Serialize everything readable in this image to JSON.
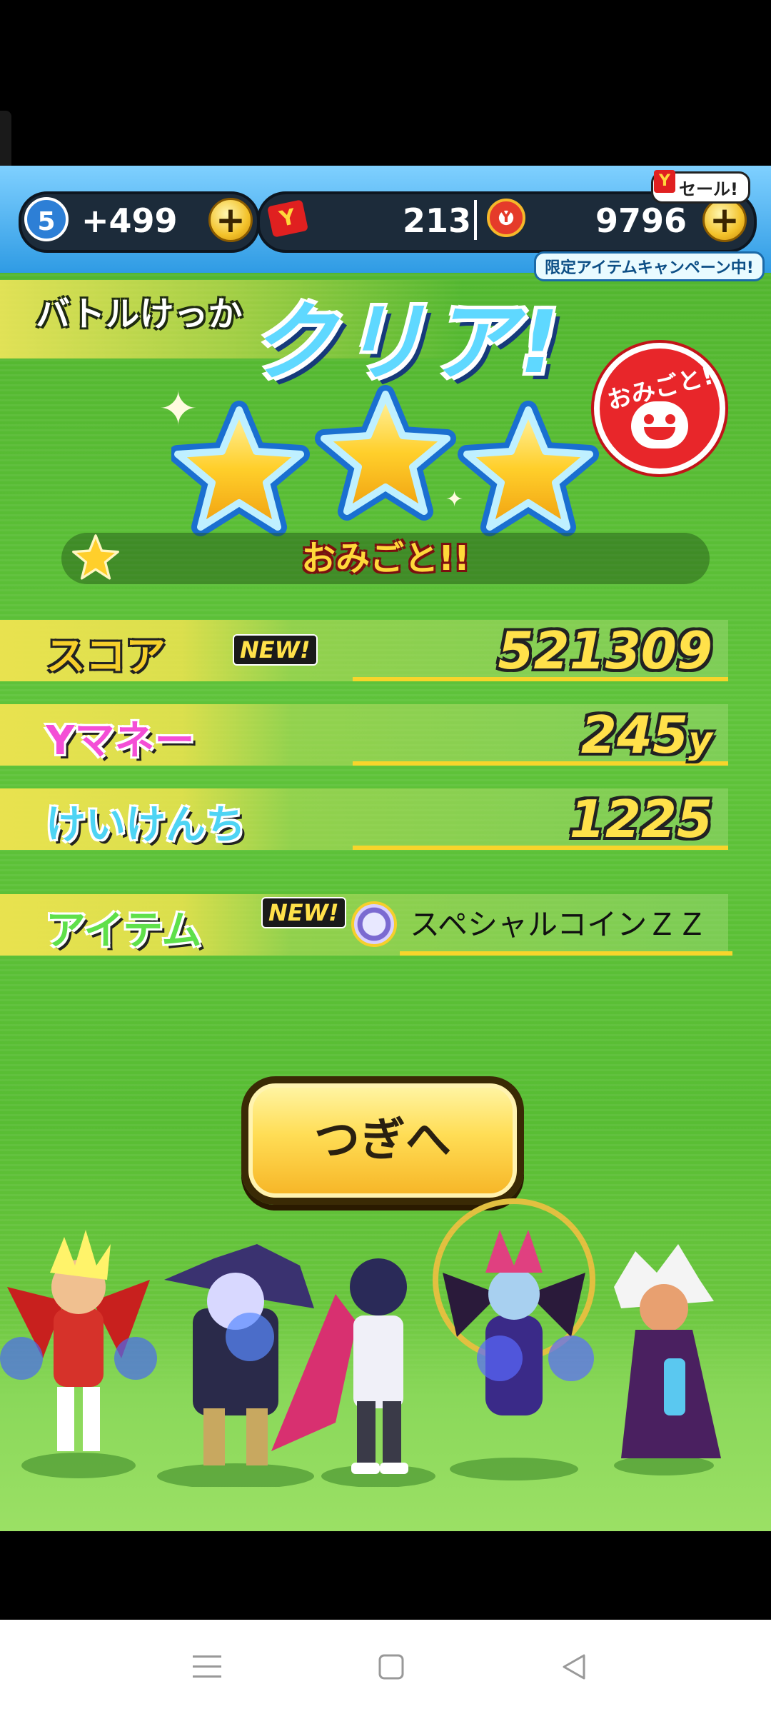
{
  "status_bar": {
    "level": "5",
    "stamina": "+499",
    "tickets": "213",
    "coins": "9796",
    "sale_label": "セール!",
    "campaign_label": "限定アイテムキャンペーン中!"
  },
  "result": {
    "battle_label": "バトルけっか",
    "clear_label": "クリア!",
    "stars": 3,
    "grade_text": "おみごと!!",
    "stamp_text": "おみごと!"
  },
  "rows": {
    "score": {
      "label": "スコア",
      "value": "521309",
      "new_badge": "NEW!"
    },
    "money": {
      "label": "Yマネー",
      "value": "245",
      "unit": "y"
    },
    "exp": {
      "label": "けいけんち",
      "value": "1225"
    },
    "item": {
      "label": "アイテム",
      "new_badge": "NEW!",
      "name": "スペシャルコインＺＺ"
    }
  },
  "next_button": {
    "label": "つぎへ"
  },
  "icons": {
    "level": "level-badge-icon",
    "plus": "plus-icon",
    "ticket": "y-ticket-icon",
    "medal": "yokai-medal-icon",
    "star": "star-icon",
    "coin": "special-coin-icon",
    "nav_menu": "menu-icon",
    "nav_home": "square-icon",
    "nav_back": "back-triangle-icon"
  },
  "colors": {
    "background": "#5fc33a",
    "button": "#ffdd55",
    "score_label": "#f6cf2b",
    "money_label": "#f44ed6",
    "exp_label": "#4ed4f4",
    "item_label": "#5fe04a"
  }
}
